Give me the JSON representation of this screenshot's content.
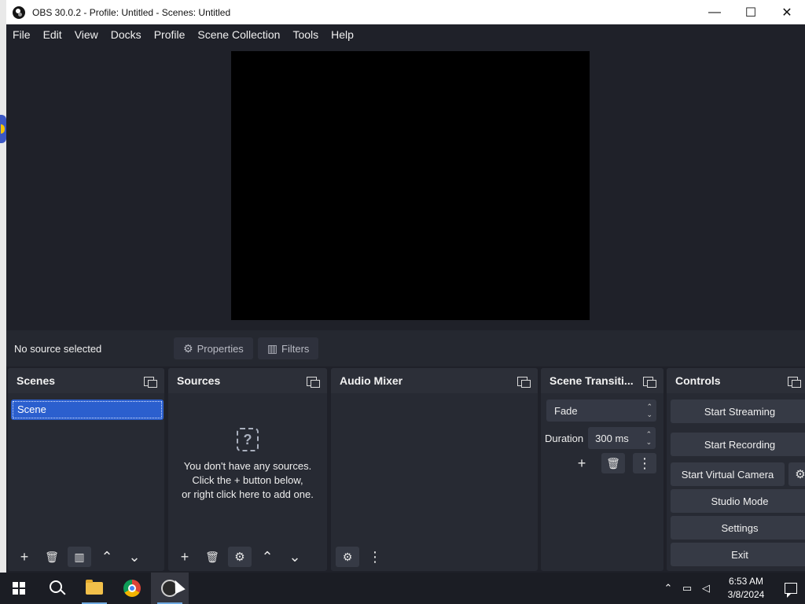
{
  "window": {
    "title": "OBS 30.0.2 - Profile: Untitled - Scenes: Untitled",
    "minimize": "—",
    "maximize": "☐",
    "close": "✕"
  },
  "menu": [
    "File",
    "Edit",
    "View",
    "Docks",
    "Profile",
    "Scene Collection",
    "Tools",
    "Help"
  ],
  "source_bar": {
    "status": "No source selected",
    "properties": "Properties",
    "filters": "Filters"
  },
  "docks": {
    "scenes": {
      "title": "Scenes",
      "items": [
        "Scene"
      ]
    },
    "sources": {
      "title": "Sources",
      "help_glyph": "?",
      "empty_line1": "You don't have any sources.",
      "empty_line2": "Click the + button below,",
      "empty_line3": "or right click here to add one."
    },
    "audio_mixer": {
      "title": "Audio Mixer"
    },
    "transitions": {
      "title": "Scene Transiti...",
      "selected": "Fade",
      "duration_label": "Duration",
      "duration_value": "300 ms"
    },
    "controls": {
      "title": "Controls",
      "start_streaming": "Start Streaming",
      "start_recording": "Start Recording",
      "start_virtual_camera": "Start Virtual Camera",
      "studio_mode": "Studio Mode",
      "settings": "Settings",
      "exit": "Exit"
    }
  },
  "icons": {
    "add": "+",
    "remove": "🗑",
    "up": "⌃",
    "down": "⌄",
    "gear": "⚙",
    "more": "⋮"
  },
  "taskbar": {
    "clock_time": "6:53 AM",
    "clock_date": "3/8/2024",
    "tray_up": "⌃"
  }
}
